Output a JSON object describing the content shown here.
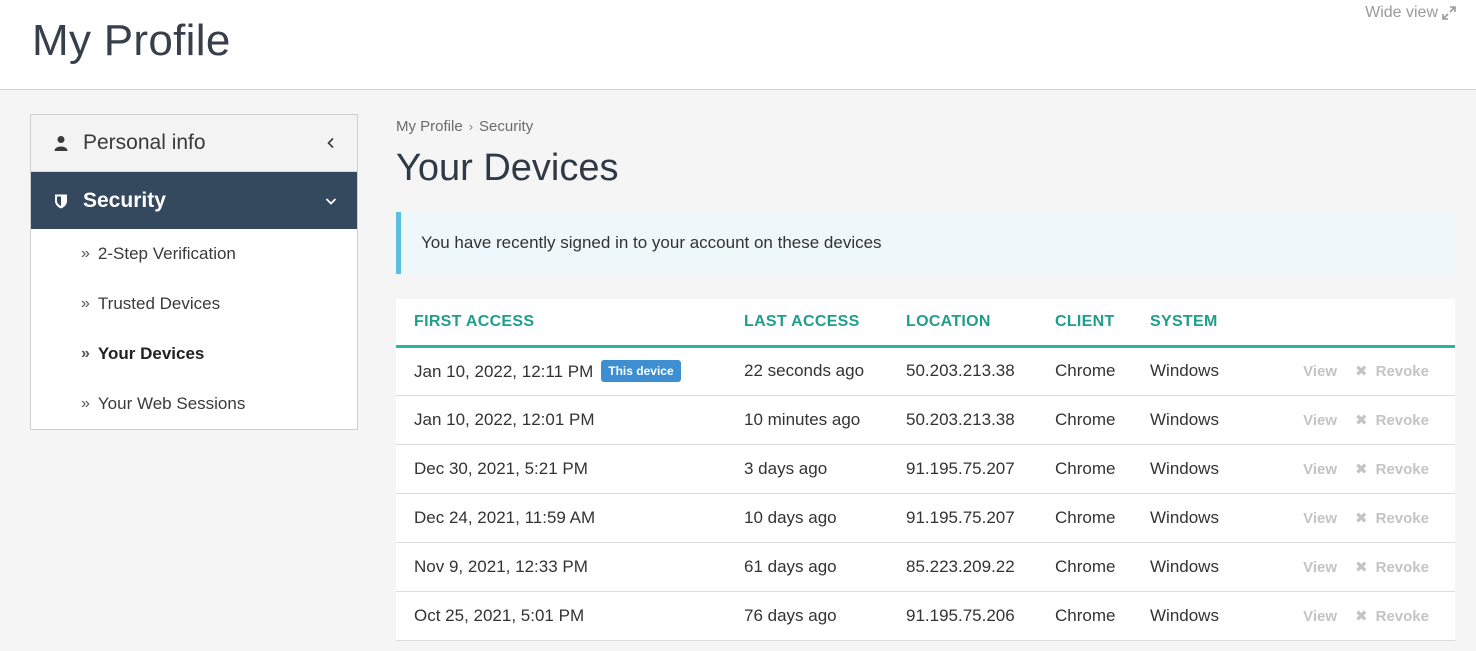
{
  "header": {
    "title": "My Profile",
    "wide_view_label": "Wide view"
  },
  "sidebar": {
    "personal_label": "Personal info",
    "security_label": "Security",
    "sub_items": [
      {
        "label": "2-Step Verification"
      },
      {
        "label": "Trusted Devices"
      },
      {
        "label": "Your Devices"
      },
      {
        "label": "Your Web Sessions"
      }
    ]
  },
  "breadcrumb": {
    "root": "My Profile",
    "current": "Security"
  },
  "main": {
    "title": "Your Devices",
    "info": "You have recently signed in to your account on these devices"
  },
  "table": {
    "headers": {
      "first_access": "FIRST ACCESS",
      "last_access": "LAST ACCESS",
      "location": "LOCATION",
      "client": "CLIENT",
      "system": "SYSTEM"
    },
    "this_device_badge": "This device",
    "view_label": "View",
    "revoke_label": "Revoke",
    "rows": [
      {
        "first": "Jan 10, 2022, 12:11 PM",
        "last": "22 seconds ago",
        "location": "50.203.213.38",
        "client": "Chrome",
        "system": "Windows"
      },
      {
        "first": "Jan 10, 2022, 12:01 PM",
        "last": "10 minutes ago",
        "location": "50.203.213.38",
        "client": "Chrome",
        "system": "Windows"
      },
      {
        "first": "Dec 30, 2021, 5:21 PM",
        "last": "3 days ago",
        "location": "91.195.75.207",
        "client": "Chrome",
        "system": "Windows"
      },
      {
        "first": "Dec 24, 2021, 11:59 AM",
        "last": "10 days ago",
        "location": "91.195.75.207",
        "client": "Chrome",
        "system": "Windows"
      },
      {
        "first": "Nov 9, 2021, 12:33 PM",
        "last": "61 days ago",
        "location": "85.223.209.22",
        "client": "Chrome",
        "system": "Windows"
      },
      {
        "first": "Oct 25, 2021, 5:01 PM",
        "last": "76 days ago",
        "location": "91.195.75.206",
        "client": "Chrome",
        "system": "Windows"
      }
    ]
  },
  "colors": {
    "sidebar_active_bg": "#34495e",
    "table_header_accent": "#2ab59e",
    "info_accent": "#5bc0de",
    "badge_bg": "#3d8fd1"
  }
}
